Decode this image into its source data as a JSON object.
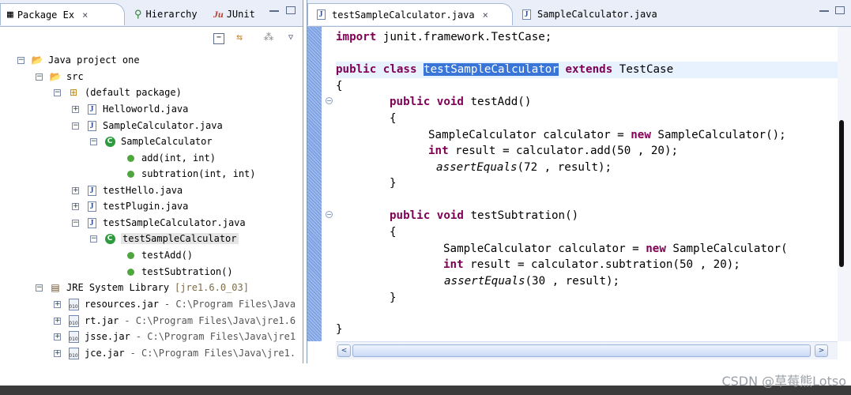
{
  "left_panel": {
    "tabs": [
      {
        "label": "Package Ex",
        "icon": "package-explorer-icon"
      },
      {
        "label": "Hierarchy",
        "icon": "hierarchy-icon"
      },
      {
        "label": "JUnit",
        "icon": "junit-icon"
      }
    ],
    "toolbar_icons": [
      "collapse-all-icon",
      "link-with-editor-icon",
      "view-menu-icon",
      "chevron-down-icon"
    ],
    "tree": [
      {
        "label": "Java project one",
        "expander": "−"
      },
      {
        "label": "src",
        "expander": "−"
      },
      {
        "label": "(default package)",
        "expander": "−"
      },
      {
        "label": "Helloworld.java",
        "expander": "+"
      },
      {
        "label": "SampleCalculator.java",
        "expander": "−"
      },
      {
        "label": "SampleCalculator",
        "expander": "−"
      },
      {
        "label": "add(int, int)"
      },
      {
        "label": "subtration(int, int)"
      },
      {
        "label": "testHello.java",
        "expander": "+"
      },
      {
        "label": "testPlugin.java",
        "expander": "+"
      },
      {
        "label": "testSampleCalculator.java",
        "expander": "−"
      },
      {
        "label": "testSampleCalculator",
        "expander": "−"
      },
      {
        "label": "testAdd()"
      },
      {
        "label": "testSubtration()"
      },
      {
        "label": "JRE System Library",
        "suffix": "[jre1.6.0_03]",
        "expander": "−"
      },
      {
        "label": "resources.jar",
        "suffix": "- C:\\Program Files\\Java",
        "expander": "+"
      },
      {
        "label": "rt.jar",
        "suffix": "- C:\\Program Files\\Java\\jre1.6",
        "expander": "+"
      },
      {
        "label": "jsse.jar",
        "suffix": "- C:\\Program Files\\Java\\jre1",
        "expander": "+"
      },
      {
        "label": "jce.jar",
        "suffix": "- C:\\Program Files\\Java\\jre1.",
        "expander": "+"
      }
    ]
  },
  "editor": {
    "tabs": [
      {
        "label": "testSampleCalculator.java",
        "active": true
      },
      {
        "label": "SampleCalculator.java",
        "active": false
      }
    ],
    "code": {
      "l1": {
        "kw": "import",
        "rest": " junit.framework.TestCase;"
      },
      "l3": {
        "kw1": "public",
        "kw2": "class",
        "name": "testSampleCalculator",
        "kw3": "extends",
        "base": "TestCase"
      },
      "l4": "{",
      "l5": {
        "kw1": "public",
        "kw2": "void",
        "name": "testAdd()"
      },
      "l6": "{",
      "l7": {
        "a": "SampleCalculator calculator = ",
        "kw": "new",
        "b": " SampleCalculator();"
      },
      "l8": {
        "kw": "int",
        "rest": " result = calculator.add(50 , 20);"
      },
      "l9": {
        "call": "assertEquals",
        "rest": "(72 , result);"
      },
      "l10": "}",
      "l12": {
        "kw1": "public",
        "kw2": "void",
        "name": "testSubtration()"
      },
      "l13": "{",
      "l14": {
        "a": "SampleCalculator calculator = ",
        "kw": "new",
        "b": " SampleCalculator("
      },
      "l15": {
        "kw": "int",
        "rest": " result = calculator.subtration(50 , 20);"
      },
      "l16": {
        "call": "assertEquals",
        "rest": "(30 , result);"
      },
      "l17": "}",
      "l19": "}"
    }
  },
  "scroll_arrows": {
    "left": "<",
    "right": ">"
  },
  "window_buttons": {
    "close": "×",
    "fold": "−"
  },
  "watermark": "CSDN @草莓熊Lotso"
}
